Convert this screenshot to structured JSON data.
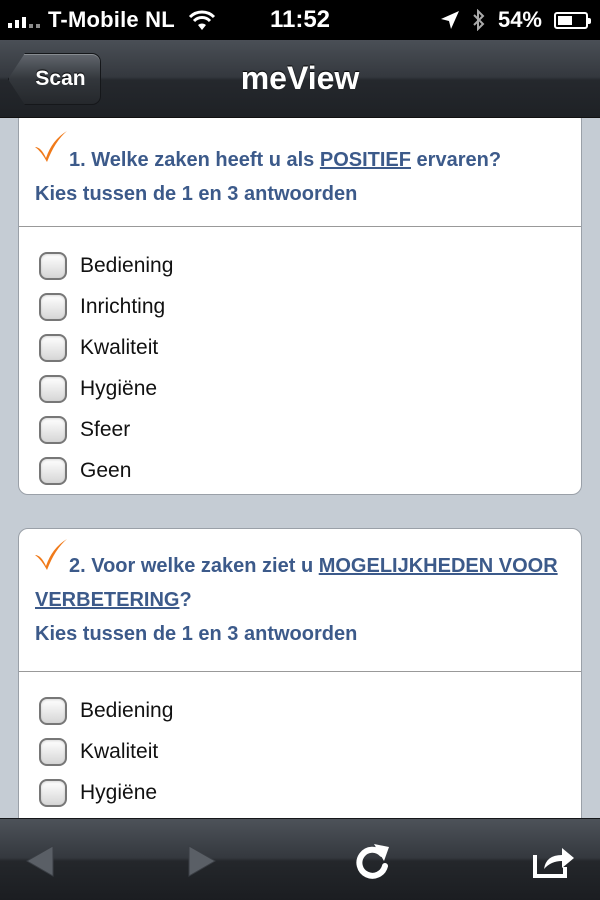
{
  "status_bar": {
    "carrier": "T-Mobile NL",
    "time": "11:52",
    "battery_percent": "54%",
    "battery_level": 0.54,
    "icons": [
      "signal-icon",
      "wifi-icon",
      "location-icon",
      "bluetooth-icon",
      "battery-icon"
    ]
  },
  "nav": {
    "back_label": "Scan",
    "title": "meView"
  },
  "questions": [
    {
      "prefix": "1. Welke zaken heeft u als ",
      "emphasis": "POSITIEF",
      "suffix": " ervaren?",
      "subtitle": "Kies tussen de 1 en 3 antwoorden",
      "options": [
        "Bediening",
        "Inrichting",
        "Kwaliteit",
        "Hygiëne",
        "Sfeer",
        "Geen"
      ]
    },
    {
      "prefix": "2. Voor welke zaken ziet u ",
      "emphasis": "MOGELIJKHEDEN VOOR VERBETERING",
      "suffix": "?",
      "subtitle": "Kies tussen de 1 en 3 antwoorden",
      "options": [
        "Bediening",
        "Kwaliteit",
        "Hygiëne"
      ]
    }
  ],
  "toolbar": {
    "icons": [
      "back-arrow-icon",
      "forward-arrow-icon",
      "reload-icon",
      "share-icon"
    ]
  },
  "colors": {
    "question_text": "#3c5a8a",
    "check_icon": "#f07a1a",
    "bar_dark": "#25282d"
  }
}
